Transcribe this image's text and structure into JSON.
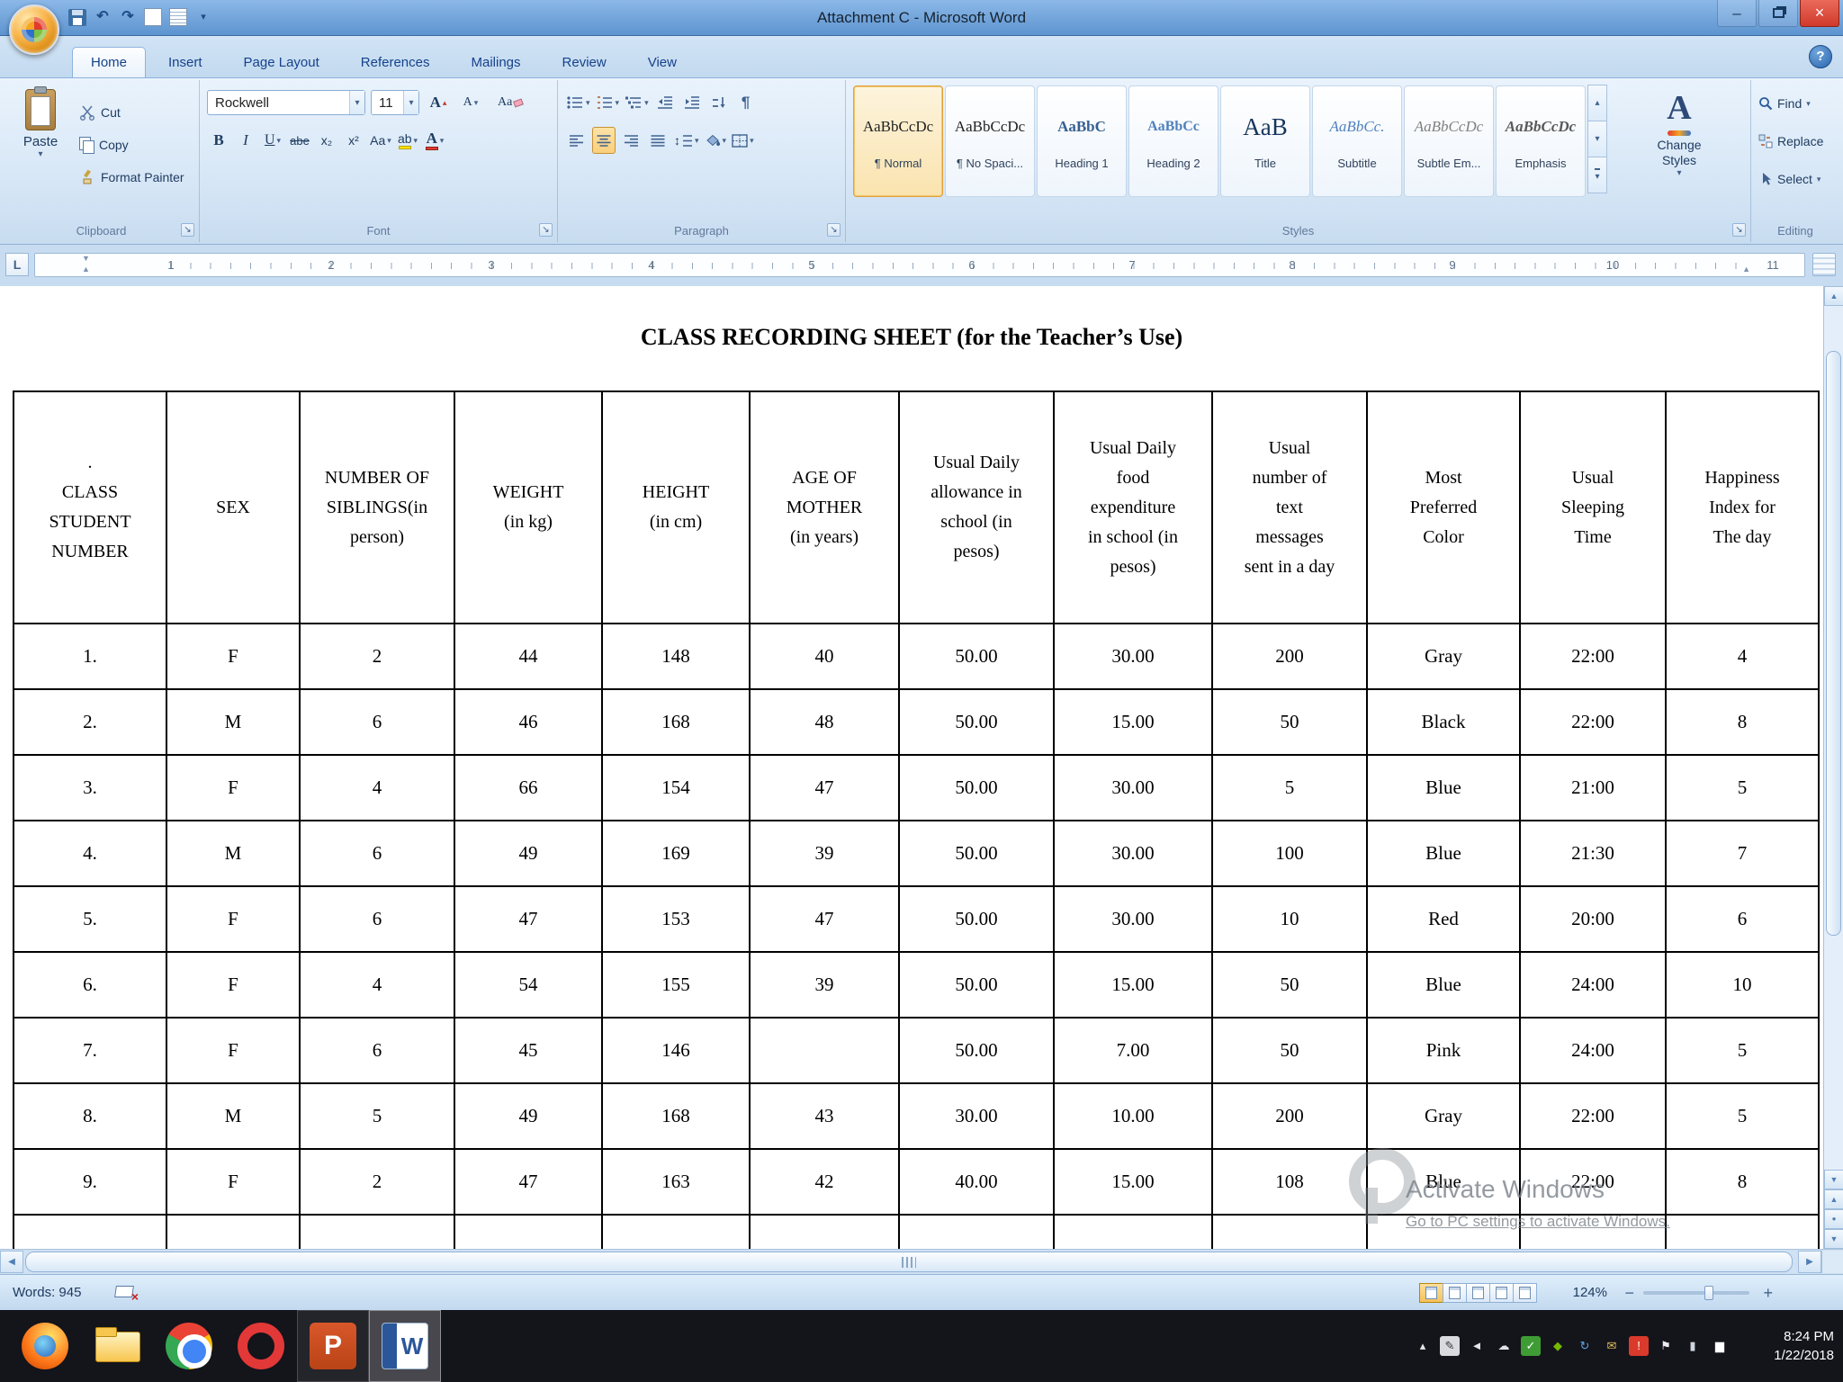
{
  "icons": {
    "dropdown": "▾",
    "up": "▲",
    "down": "▼",
    "left": "◀",
    "right": "▶",
    "small_up": "▴",
    "help": "?",
    "close": "×",
    "minimize": "–",
    "launcher": "↘",
    "pilcrow": "¶",
    "updown": "↕",
    "ball": "●",
    "tab_stop": "L",
    "proof_x": "×",
    "zoom_out": "−",
    "zoom_in": "+"
  },
  "window": {
    "title": "Attachment C - Microsoft Word"
  },
  "quick_access": {
    "buttons": [
      {
        "name": "save",
        "glyph": ""
      },
      {
        "name": "undo",
        "glyph": "↶"
      },
      {
        "name": "redo",
        "glyph": "↷"
      },
      {
        "name": "new-document",
        "glyph": ""
      },
      {
        "name": "print-preview",
        "glyph": ""
      },
      {
        "name": "customize-quick-access",
        "glyph": "▾"
      }
    ]
  },
  "tabs": {
    "items": [
      "Home",
      "Insert",
      "Page Layout",
      "References",
      "Mailings",
      "Review",
      "View"
    ],
    "active": "Home"
  },
  "ribbon": {
    "clipboard": {
      "group_label": "Clipboard",
      "paste": "Paste",
      "cut": "Cut",
      "copy": "Copy",
      "format_painter": "Format Painter"
    },
    "font": {
      "group_label": "Font",
      "font_name": "Rockwell",
      "font_size": "11",
      "bold": "B",
      "italic": "I",
      "underline": "U",
      "strikethrough": "abe",
      "subscript": "x₂",
      "superscript": "x²",
      "change_case": "Aa",
      "grow_font": "A",
      "shrink_font": "A",
      "clear_formatting": "Aa",
      "highlight": "ab",
      "font_color": "A"
    },
    "paragraph": {
      "group_label": "Paragraph"
    },
    "styles": {
      "group_label": "Styles",
      "change_styles": "Change Styles",
      "change_styles_icon": "A",
      "items": [
        {
          "preview": "AaBbCcDc",
          "name": "¶ Normal"
        },
        {
          "preview": "AaBbCcDc",
          "name": "¶ No Spaci..."
        },
        {
          "preview": "AaBbC",
          "name": "Heading 1"
        },
        {
          "preview": "AaBbCc",
          "name": "Heading 2"
        },
        {
          "preview": "AaB",
          "name": "Title"
        },
        {
          "preview": "AaBbCc.",
          "name": "Subtitle"
        },
        {
          "preview": "AaBbCcDc",
          "name": "Subtle Em..."
        },
        {
          "preview": "AaBbCcDc",
          "name": "Emphasis"
        }
      ]
    },
    "editing": {
      "group_label": "Editing",
      "find": "Find",
      "replace": "Replace",
      "select": "Select"
    }
  },
  "ruler": {
    "numbers": [
      "1",
      "2",
      "3",
      "4",
      "5",
      "6",
      "7",
      "8",
      "9",
      "10",
      "11"
    ]
  },
  "document": {
    "title": "CLASS RECORDING SHEET (for the Teacher’s Use)",
    "table": {
      "headers": [
        ".\nCLASS\nSTUDENT\nNUMBER",
        "SEX",
        "NUMBER OF\nSIBLINGS(in\nperson)",
        "WEIGHT\n(in kg)",
        "HEIGHT\n(in cm)",
        "AGE OF\nMOTHER\n(in years)",
        "Usual Daily\nallowance in\nschool (in\npesos)",
        "Usual Daily\nfood\nexpenditure\nin school (in\npesos)",
        "Usual\nnumber of\ntext\nmessages\nsent in a day",
        "Most\nPreferred\nColor",
        "Usual\nSleeping\nTime",
        "Happiness\nIndex for\nThe day"
      ],
      "rows": [
        [
          "1.",
          "F",
          "2",
          "44",
          "148",
          "40",
          "50.00",
          "30.00",
          "200",
          "Gray",
          "22:00",
          "4"
        ],
        [
          "2.",
          "M",
          "6",
          "46",
          "168",
          "48",
          "50.00",
          "15.00",
          "50",
          "Black",
          "22:00",
          "8"
        ],
        [
          "3.",
          "F",
          "4",
          "66",
          "154",
          "47",
          "50.00",
          "30.00",
          "5",
          "Blue",
          "21:00",
          "5"
        ],
        [
          "4.",
          "M",
          "6",
          "49",
          "169",
          "39",
          "50.00",
          "30.00",
          "100",
          "Blue",
          "21:30",
          "7"
        ],
        [
          "5.",
          "F",
          "6",
          "47",
          "153",
          "47",
          "50.00",
          "30.00",
          "10",
          "Red",
          "20:00",
          "6"
        ],
        [
          "6.",
          "F",
          "4",
          "54",
          "155",
          "39",
          "50.00",
          "15.00",
          "50",
          "Blue",
          "24:00",
          "10"
        ],
        [
          "7.",
          "F",
          "6",
          "45",
          "146",
          "",
          "50.00",
          "7.00",
          "50",
          "Pink",
          "24:00",
          "5"
        ],
        [
          "8.",
          "M",
          "5",
          "49",
          "168",
          "43",
          "30.00",
          "10.00",
          "200",
          "Gray",
          "22:00",
          "5"
        ],
        [
          "9.",
          "F",
          "2",
          "47",
          "163",
          "42",
          "40.00",
          "15.00",
          "108",
          "Blue",
          "22:00",
          "8"
        ],
        [
          "",
          "",
          "",
          "",
          "",
          "",
          "",
          "",
          "",
          "",
          "",
          ""
        ]
      ]
    }
  },
  "watermark": {
    "line1": "Activate Windows",
    "line2": "Go to PC settings to activate Windows."
  },
  "status_bar": {
    "words": "Words: 945",
    "zoom": "124%"
  },
  "taskbar": {
    "clock_time": "8:24 PM",
    "clock_date": "1/22/2018",
    "apps": [
      {
        "name": "firefox",
        "open": false,
        "active": false
      },
      {
        "name": "file-explorer",
        "open": false,
        "active": false
      },
      {
        "name": "chrome",
        "open": false,
        "active": false
      },
      {
        "name": "opera",
        "open": false,
        "active": false
      },
      {
        "name": "powerpoint",
        "open": true,
        "active": false
      },
      {
        "name": "word",
        "open": true,
        "active": true
      }
    ],
    "tray": [
      {
        "name": "show-hidden-icons",
        "glyph": "▴",
        "bg": "transparent",
        "color": "#e6e6e6"
      },
      {
        "name": "pen-input",
        "glyph": "✎",
        "bg": "#d8dadd",
        "color": "#3a3a3a"
      },
      {
        "name": "volume",
        "glyph": "◄",
        "bg": "transparent",
        "color": "#e6e6e6"
      },
      {
        "name": "cloud-sync",
        "glyph": "☁",
        "bg": "transparent",
        "color": "#dfe3e8"
      },
      {
        "name": "security-shield",
        "glyph": "✓",
        "bg": "#3f9c35",
        "color": "#ffffff"
      },
      {
        "name": "graphics",
        "glyph": "◆",
        "bg": "transparent",
        "color": "#76b900"
      },
      {
        "name": "update",
        "glyph": "↻",
        "bg": "transparent",
        "color": "#63a4e4"
      },
      {
        "name": "mail",
        "glyph": "✉",
        "bg": "transparent",
        "color": "#e0c25a"
      },
      {
        "name": "alert",
        "glyph": "!",
        "bg": "#d93a2b",
        "color": "#ffffff"
      },
      {
        "name": "flag",
        "glyph": "⚑",
        "bg": "transparent",
        "color": "#e8eef4"
      },
      {
        "name": "battery",
        "glyph": "▮",
        "bg": "transparent",
        "color": "#cfd6dd"
      },
      {
        "name": "network",
        "glyph": "▆",
        "bg": "transparent",
        "color": "#ffffff"
      }
    ]
  }
}
